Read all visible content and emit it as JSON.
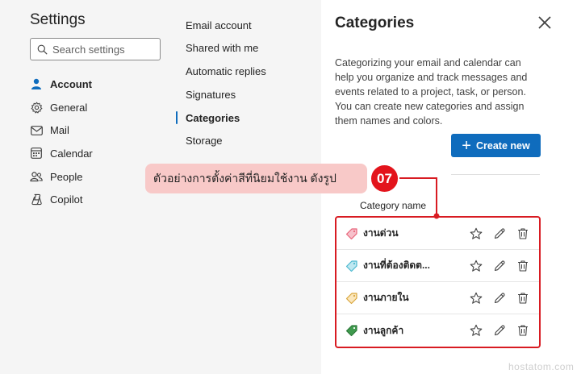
{
  "settings": {
    "title": "Settings",
    "search_placeholder": "Search settings",
    "nav": [
      {
        "label": "Account",
        "icon": "person-icon",
        "active": true
      },
      {
        "label": "General",
        "icon": "gear-icon",
        "active": false
      },
      {
        "label": "Mail",
        "icon": "mail-icon",
        "active": false
      },
      {
        "label": "Calendar",
        "icon": "calendar-icon",
        "active": false
      },
      {
        "label": "People",
        "icon": "people-icon",
        "active": false
      },
      {
        "label": "Copilot",
        "icon": "copilot-icon",
        "active": false
      }
    ]
  },
  "submenu": {
    "items": [
      {
        "label": "Email account",
        "active": false
      },
      {
        "label": "Shared with me",
        "active": false
      },
      {
        "label": "Automatic replies",
        "active": false
      },
      {
        "label": "Signatures",
        "active": false
      },
      {
        "label": "Categories",
        "active": true
      },
      {
        "label": "Storage",
        "active": false
      }
    ]
  },
  "panel": {
    "title": "Categories",
    "description": "Categorizing your email and calendar can help you organize and track messages and events related to a project, task, or person. You can create new categories and assign them names and colors.",
    "create_button": "Create new",
    "column_header": "Category name",
    "categories": [
      {
        "name": "งานด่วน",
        "color": "#e8647a"
      },
      {
        "name": "งานที่ต้องติดต...",
        "color": "#4ab8cf"
      },
      {
        "name": "งานภายใน",
        "color": "#f0c46a"
      },
      {
        "name": "งานลูกค้า",
        "color": "#3f9a4e"
      }
    ]
  },
  "annotation": {
    "text": "ตัวอย่างการตั้งค่าสีที่นิยมใช้งาน ดังรูป",
    "step": "07"
  },
  "watermark": "hostatom.com",
  "colors": {
    "accent": "#0f6cbd",
    "annotation_red": "#d81b22",
    "callout_bg": "#f8c9c8"
  }
}
